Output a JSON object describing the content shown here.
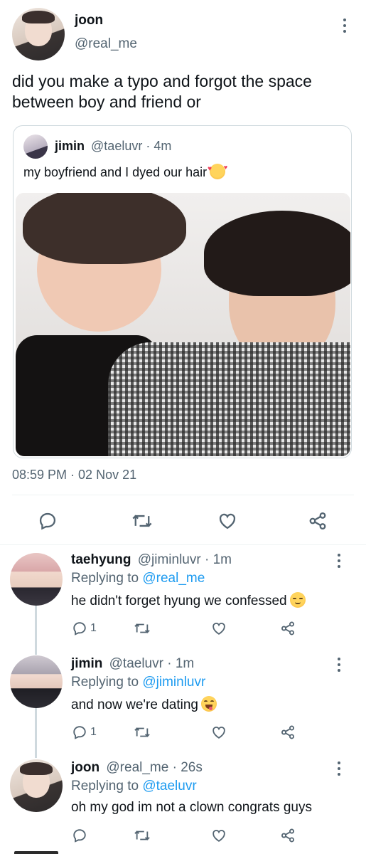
{
  "main_tweet": {
    "display_name": "joon",
    "handle": "@real_me",
    "text": "did you make a typo and forgot the space between boy and friend or",
    "timestamp": "08:59 PM · 02 Nov 21",
    "quoted": {
      "display_name": "jimin",
      "meta": "@taeluvr · 4m",
      "text": "my boyfriend and I dyed our hair"
    }
  },
  "replies": [
    {
      "display_name": "taehyung",
      "meta": "@jiminluvr · 1m",
      "replying_prefix": "Replying to",
      "replying_to": "@real_me",
      "text": "he didn't forget hyung we confessed",
      "reply_count": "1"
    },
    {
      "display_name": "jimin",
      "meta": "@taeluvr · 1m",
      "replying_prefix": "Replying to",
      "replying_to": "@jiminluvr",
      "text": "and now we're dating",
      "reply_count": "1"
    },
    {
      "display_name": "joon",
      "meta": "@real_me · 26s",
      "replying_prefix": "Replying to",
      "replying_to": "@taeluvr",
      "text": "oh my god im not a clown congrats guys",
      "reply_count": ""
    }
  ],
  "colors": {
    "text": "#0f1419",
    "muted": "#536471",
    "link": "#1d9bf0",
    "divider": "#eff3f4"
  }
}
